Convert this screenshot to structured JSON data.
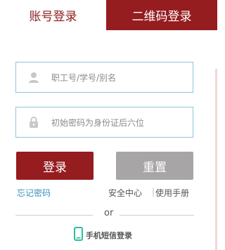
{
  "tabs": {
    "account_label": "账号登录",
    "qr_label": "二维码登录"
  },
  "form": {
    "username_placeholder": "职工号/学号/别名",
    "password_placeholder": "初始密码为身份证后六位"
  },
  "buttons": {
    "login_label": "登录",
    "reset_label": "重置"
  },
  "links": {
    "forgot_password": "忘记密码",
    "security_center": "安全中心",
    "separator": "|",
    "user_manual": "使用手册"
  },
  "divider": {
    "or_text": "or"
  },
  "sms": {
    "label": "手机短信登录"
  },
  "colors": {
    "brand": "#951c1f",
    "reset": "#a7a5a5",
    "link": "#3b8fc2",
    "input_border": "#8ec3dc",
    "phone_icon": "#2bbf98"
  },
  "icons": {
    "username": "user-icon",
    "password": "lock-icon",
    "sms": "phone-icon"
  }
}
